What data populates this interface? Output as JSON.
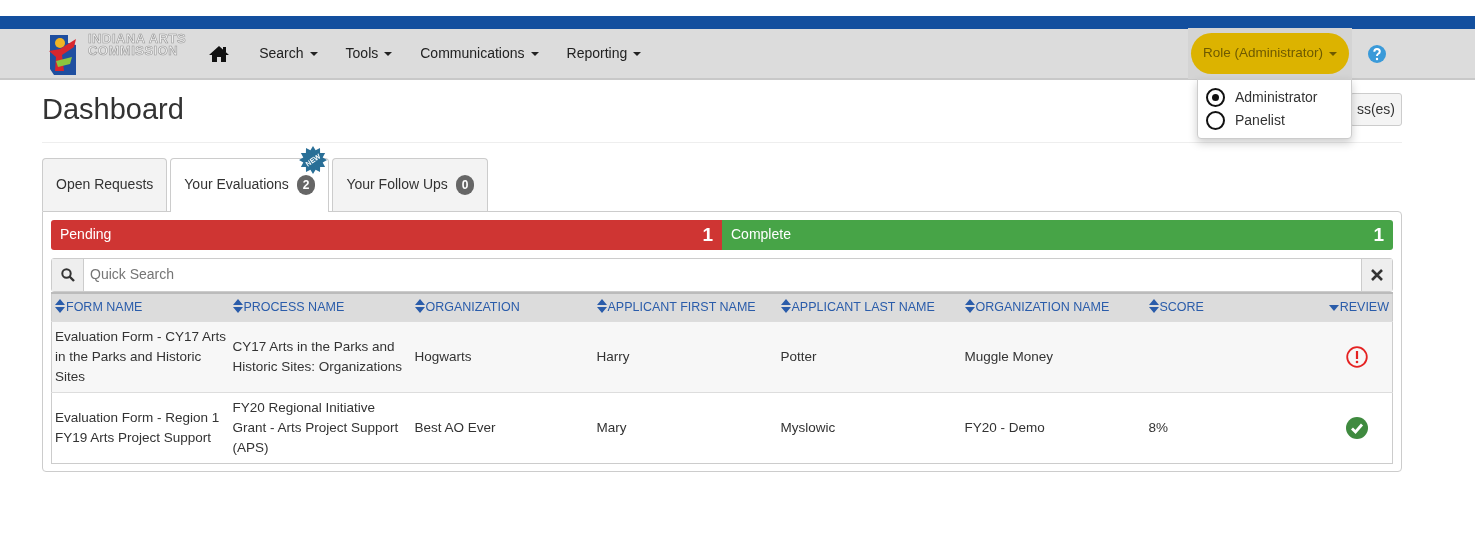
{
  "logo": {
    "line_1": "INDIANA ARTS",
    "line_2": "COMMISSION"
  },
  "nav": {
    "items": [
      {
        "label": "Search"
      },
      {
        "label": "Tools"
      },
      {
        "label": "Communications"
      },
      {
        "label": "Reporting"
      }
    ],
    "role_menu": {
      "label": "Role (Administrator)",
      "expanded": true,
      "highlighted": true,
      "options": [
        {
          "label": "Administrator",
          "selected": true
        },
        {
          "label": "Panelist",
          "selected": false
        }
      ]
    }
  },
  "page_title": "Dashboard",
  "hidden_button": {
    "label": "ss(es)"
  },
  "tabs": [
    {
      "label": "Open Requests",
      "selected": false
    },
    {
      "label": "Your Evaluations",
      "count": "2",
      "new_badge": "NEW",
      "selected": true
    },
    {
      "label": "Your Follow Ups",
      "count": "0",
      "selected": false
    }
  ],
  "progress": [
    {
      "label": "Pending",
      "count": "1",
      "color": "#cf3533"
    },
    {
      "label": "Complete",
      "count": "1",
      "color": "#47a447"
    }
  ],
  "search": {
    "placeholder": "Quick Search"
  },
  "table": {
    "columns": [
      {
        "label": "FORM NAME",
        "sorted": false
      },
      {
        "label": "PROCESS NAME",
        "sorted": false
      },
      {
        "label": "ORGANIZATION",
        "sorted": false
      },
      {
        "label": "APPLICANT FIRST NAME",
        "sorted": false
      },
      {
        "label": "APPLICANT LAST NAME",
        "sorted": false
      },
      {
        "label": "ORGANIZATION NAME",
        "sorted": false
      },
      {
        "label": "SCORE",
        "sorted": false
      },
      {
        "label": "REVIEW",
        "sorted": true
      }
    ],
    "rows": [
      {
        "cells": [
          "Evaluation Form - CY17 Arts in the Parks and Historic Sites",
          "CY17 Arts in the Parks and Historic Sites: Organizations",
          "Hogwarts",
          "Harry",
          "Potter",
          "Muggle Money",
          ""
        ],
        "complete": false
      },
      {
        "cells": [
          "Evaluation Form - Region 1 FY19 Arts Project Support",
          "FY20 Regional Initiative Grant - Arts Project Support (APS)",
          "Best AO Ever",
          "Mary",
          "Myslowic",
          "FY20 - Demo",
          "8%"
        ],
        "complete": true
      }
    ]
  }
}
